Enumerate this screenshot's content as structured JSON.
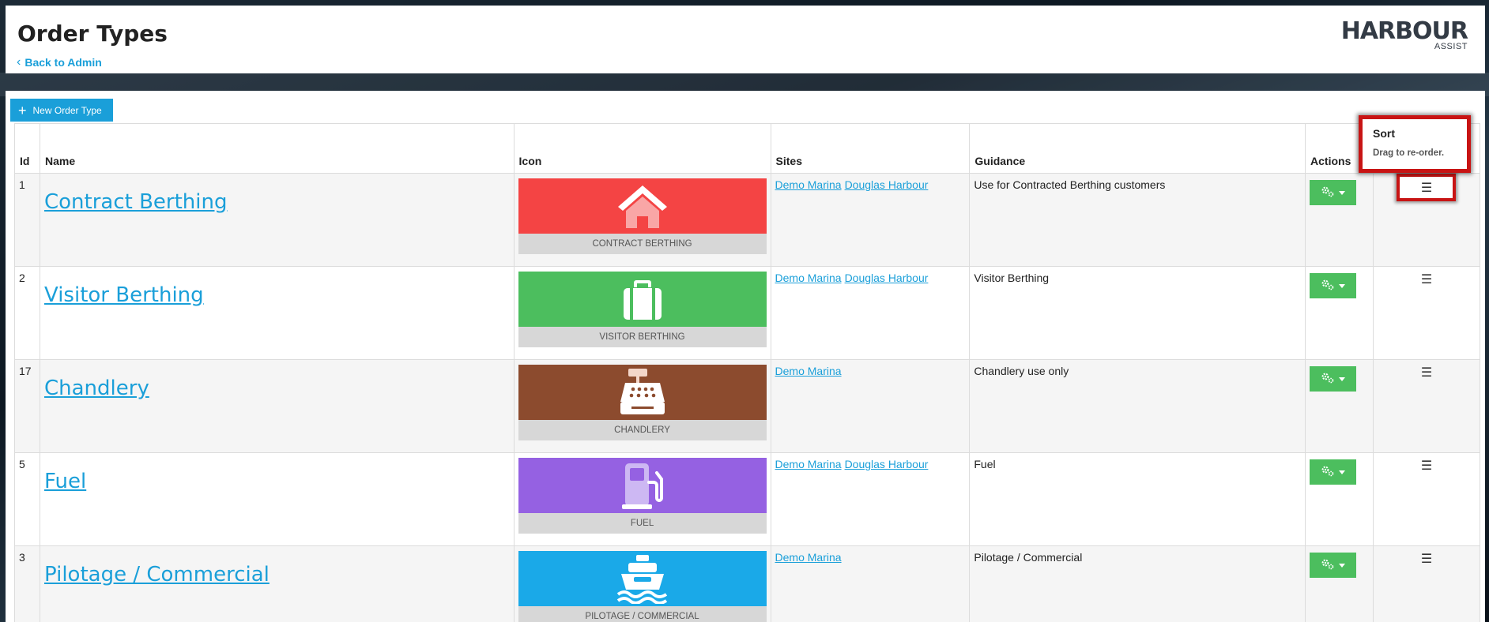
{
  "header": {
    "title": "Order Types",
    "back_link": "Back to Admin",
    "logo_main": "HARBOUR",
    "logo_sub": "ASSIST"
  },
  "toolbar": {
    "new_button": "New Order Type"
  },
  "table": {
    "headers": {
      "id": "Id",
      "name": "Name",
      "icon": "Icon",
      "sites": "Sites",
      "guidance": "Guidance",
      "actions": "Actions",
      "sort": "Sort",
      "sort_hint": "Drag to re-order."
    },
    "sort_glyph": "☰",
    "rows": [
      {
        "id": "1",
        "name": "Contract Berthing",
        "icon_label": "CONTRACT BERTHING",
        "icon_name": "house-icon",
        "icon_color": "#f44444",
        "sites": [
          "Demo Marina",
          "Douglas Harbour"
        ],
        "guidance": "Use for Contracted Berthing customers"
      },
      {
        "id": "2",
        "name": "Visitor Berthing",
        "icon_label": "VISITOR BERTHING",
        "icon_name": "suitcase-icon",
        "icon_color": "#4cbe5e",
        "sites": [
          "Demo Marina",
          "Douglas Harbour"
        ],
        "guidance": "Visitor Berthing"
      },
      {
        "id": "17",
        "name": "Chandlery",
        "icon_label": "CHANDLERY",
        "icon_name": "cash-register-icon",
        "icon_color": "#8c4b2e",
        "sites": [
          "Demo Marina"
        ],
        "guidance": "Chandlery use only"
      },
      {
        "id": "5",
        "name": "Fuel",
        "icon_label": "FUEL",
        "icon_name": "fuel-pump-icon",
        "icon_color": "#9561e2",
        "sites": [
          "Demo Marina",
          "Douglas Harbour"
        ],
        "guidance": "Fuel"
      },
      {
        "id": "3",
        "name": "Pilotage / Commercial",
        "icon_label": "PILOTAGE / COMMERCIAL",
        "icon_name": "ship-icon",
        "icon_color": "#1aa9e8",
        "sites": [
          "Demo Marina"
        ],
        "guidance": "Pilotage / Commercial"
      }
    ]
  }
}
